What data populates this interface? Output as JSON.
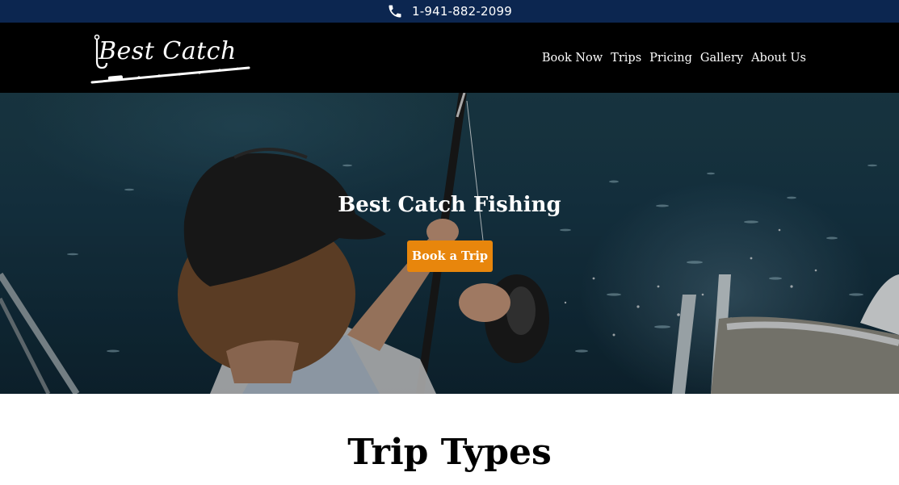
{
  "topbar": {
    "phone_icon": "phone-icon",
    "phone": "1-941-882-2099"
  },
  "header": {
    "logo_text": "Best Catch",
    "nav": [
      {
        "label": "Book Now"
      },
      {
        "label": "Trips"
      },
      {
        "label": "Pricing"
      },
      {
        "label": "Gallery"
      },
      {
        "label": "About Us"
      }
    ]
  },
  "hero": {
    "title": "Best Catch Fishing",
    "button_label": "Book a Trip"
  },
  "section": {
    "title": "Trip Types"
  },
  "colors": {
    "topbar_bg": "#0c2650",
    "header_bg": "#000000",
    "accent_button": "#e8860c"
  }
}
